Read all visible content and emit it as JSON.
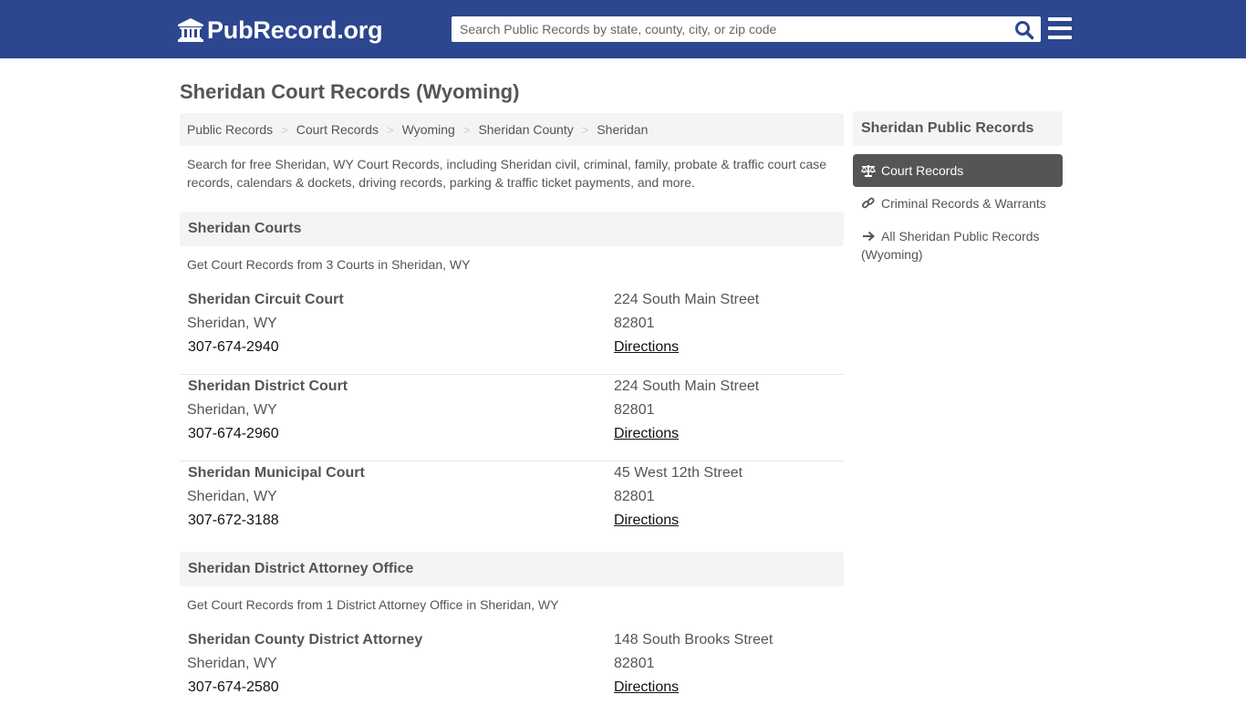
{
  "header": {
    "logo_text": "PubRecord.org",
    "search_placeholder": "Search Public Records by state, county, city, or zip code",
    "search_value": ""
  },
  "page_title": "Sheridan Court Records (Wyoming)",
  "breadcrumb": [
    "Public Records",
    "Court Records",
    "Wyoming",
    "Sheridan County",
    "Sheridan"
  ],
  "intro": "Search for free Sheridan, WY Court Records, including Sheridan civil, criminal, family, probate & traffic court case records, calendars & dockets, driving records, parking & traffic ticket payments, and more.",
  "sections": [
    {
      "title": "Sheridan Courts",
      "subtitle": "Get Court Records from 3 Courts in Sheridan, WY",
      "entries": [
        {
          "name": "Sheridan Circuit Court",
          "city": "Sheridan, WY",
          "phone": "307-674-2940",
          "address": "224 South Main Street",
          "zip": "82801",
          "directions": "Directions"
        },
        {
          "name": "Sheridan District Court",
          "city": "Sheridan, WY",
          "phone": "307-674-2960",
          "address": "224 South Main Street",
          "zip": "82801",
          "directions": "Directions"
        },
        {
          "name": "Sheridan Municipal Court",
          "city": "Sheridan, WY",
          "phone": "307-672-3188",
          "address": "45 West 12th Street",
          "zip": "82801",
          "directions": "Directions"
        }
      ]
    },
    {
      "title": "Sheridan District Attorney Office",
      "subtitle": "Get Court Records from 1 District Attorney Office in Sheridan, WY",
      "entries": [
        {
          "name": "Sheridan County District Attorney",
          "city": "Sheridan, WY",
          "phone": "307-674-2580",
          "address": "148 South Brooks Street",
          "zip": "82801",
          "directions": "Directions"
        }
      ]
    }
  ],
  "sidebar": {
    "title": "Sheridan Public Records",
    "items": [
      {
        "label": "Court Records",
        "icon": "balance-scale-icon",
        "active": true
      },
      {
        "label": "Criminal Records & Warrants",
        "icon": "link-icon",
        "active": false
      },
      {
        "label": "All Sheridan Public Records (Wyoming)",
        "icon": "arrow-right-icon",
        "active": false
      }
    ]
  },
  "colors": {
    "header_bg": "#2c4690",
    "search_icon": "#2c4690",
    "panel_bg": "#f4f4f4",
    "active_bg": "#555555",
    "text": "#555555"
  }
}
